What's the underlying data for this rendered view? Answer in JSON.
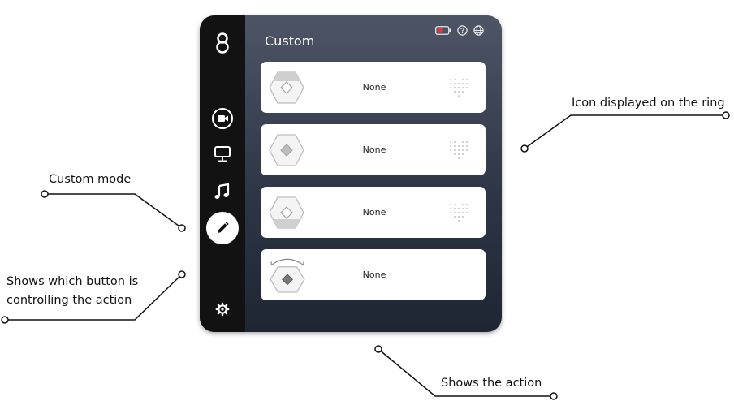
{
  "annotations": {
    "custom_mode": "Custom mode",
    "button_line1": "Shows which button is",
    "button_line2": "controlling the action",
    "ring_icon": "Icon displayed on the ring",
    "action": "Shows the action"
  },
  "app": {
    "title": "Custom",
    "sidebar": {
      "logo": "logo-icon",
      "items": [
        "video-icon",
        "monitor-icon",
        "music-icon",
        "pencil-icon"
      ],
      "active_item": "pencil-icon",
      "settings": "gear-icon"
    },
    "top_icons": [
      "battery-icon",
      "help-icon",
      "globe-icon"
    ],
    "cards": [
      {
        "action": "None",
        "button": "top"
      },
      {
        "action": "None",
        "button": "center"
      },
      {
        "action": "None",
        "button": "bottom"
      },
      {
        "action": "None",
        "button": "rotate"
      }
    ]
  },
  "colors": {
    "sidebar": "#121212",
    "panel_top": "#4d5566",
    "panel_bottom": "#1e2533",
    "battery_low": "#e53935"
  }
}
